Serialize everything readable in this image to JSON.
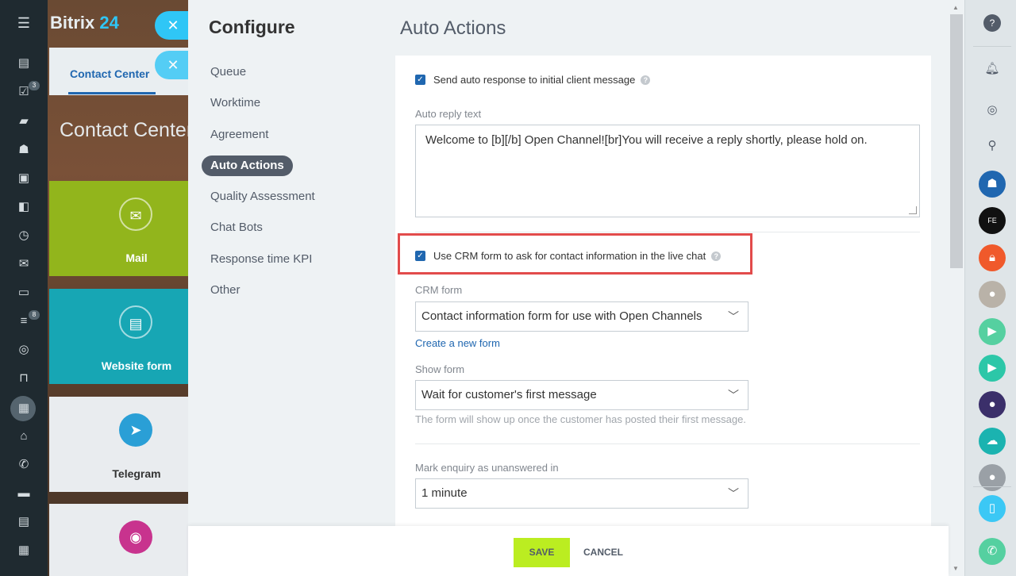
{
  "app": {
    "logo_text": "Bitrix",
    "logo_num": "24",
    "nav_badges": [
      "3",
      "8"
    ],
    "icons": {
      "menu": "hamburger-icon",
      "close": "close-icon"
    }
  },
  "background": {
    "tab_label": "Contact Center",
    "title": "Contact Center",
    "tiles": [
      {
        "label": "Mail",
        "icon": "mail-icon"
      },
      {
        "label": "Website form",
        "icon": "form-icon"
      },
      {
        "label": "Telegram",
        "icon": "telegram-icon"
      },
      {
        "label": "",
        "icon": "instagram-icon"
      }
    ]
  },
  "configure": {
    "title": "Configure",
    "items": [
      "Queue",
      "Worktime",
      "Agreement",
      "Auto Actions",
      "Quality Assessment",
      "Chat Bots",
      "Response time KPI",
      "Other"
    ],
    "active_index": 3
  },
  "page": {
    "title": "Auto Actions",
    "auto_response": {
      "label": "Send auto response to initial client message",
      "checked": true
    },
    "auto_reply_label": "Auto reply text",
    "auto_reply_text": "Welcome to [b][/b] Open Channel![br]You will receive a reply shortly, please hold on.",
    "crm": {
      "label": "Use CRM form to ask for contact information in the live chat",
      "checked": true
    },
    "crm_form_label": "CRM form",
    "crm_form_value": "Contact information form for use with Open Channels",
    "create_form_link": "Create a new form",
    "show_form_label": "Show form",
    "show_form_value": "Wait for customer's first message",
    "show_form_hint": "The form will show up once the customer has posted their first message.",
    "unanswered_label": "Mark enquiry as unanswered in",
    "unanswered_value": "1 minute"
  },
  "footer": {
    "save": "SAVE",
    "cancel": "CANCEL"
  },
  "colors": {
    "accent_blue": "#2067b0",
    "save_green": "#bbed21",
    "highlight_red": "#e24b4b",
    "bitrix_cyan": "#2fc6f6"
  }
}
